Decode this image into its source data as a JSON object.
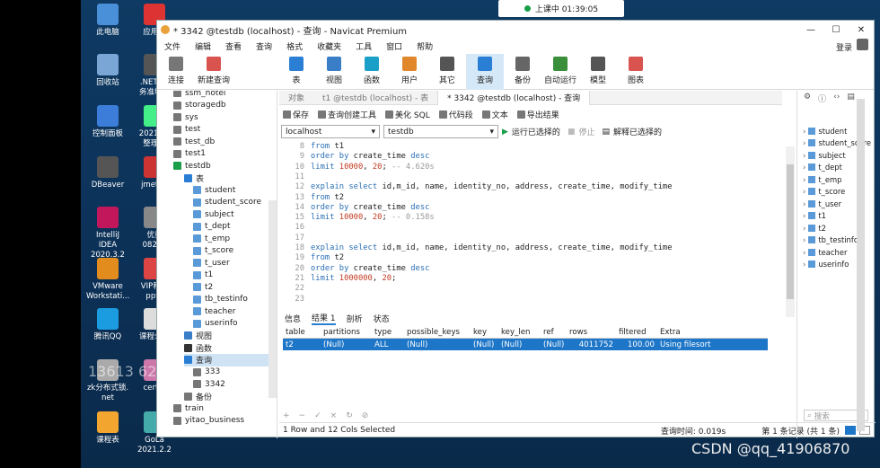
{
  "taskbar": {
    "timer": "上课中 01:39:05"
  },
  "desktop_icons": [
    {
      "label": "此电脑",
      "icon": "computer-icon"
    },
    {
      "label": "应用程",
      "icon": "app-icon"
    },
    {
      "label": "回收站",
      "icon": "recycle-bin-icon"
    },
    {
      "label": ".NET6+\n务准地质",
      "icon": "folder-icon"
    },
    {
      "label": "控制面板",
      "icon": "control-panel-icon"
    },
    {
      "label": "2021Jav\n整理笔",
      "icon": "folder-icon"
    },
    {
      "label": "DBeaver",
      "icon": "dbeaver-icon"
    },
    {
      "label": "jmeter.",
      "icon": "jmeter-icon"
    },
    {
      "label": "IntelliJ IDEA\n2020.3.2 ...",
      "icon": "intellij-icon"
    },
    {
      "label": "优重\n0823.j",
      "icon": "file-icon"
    },
    {
      "label": "VMware\nWorkstati...",
      "icon": "vmware-icon"
    },
    {
      "label": "VIP和公\npptx",
      "icon": "ppt-icon"
    },
    {
      "label": "腾讯QQ",
      "icon": "qq-icon"
    },
    {
      "label": "课程公告",
      "icon": "doc-icon"
    },
    {
      "label": "zk分布式锁.\nnet",
      "icon": "file-icon"
    },
    {
      "label": "cert.p",
      "icon": "cert-icon"
    },
    {
      "label": "课程表",
      "icon": "schedule-icon"
    },
    {
      "label": "GoLa\n2021.2.2",
      "icon": "goland-icon"
    }
  ],
  "window": {
    "title": "* 3342 @testdb (localhost) - 查询 - Navicat Premium",
    "login": "登录"
  },
  "menu": [
    "文件",
    "编辑",
    "查看",
    "查询",
    "格式",
    "收藏夹",
    "工具",
    "窗口",
    "帮助"
  ],
  "toolbar": [
    {
      "label": "连接",
      "icon": "connect-icon"
    },
    {
      "label": "新建查询",
      "icon": "new-query-icon"
    },
    {
      "label": "表",
      "icon": "table-icon"
    },
    {
      "label": "视图",
      "icon": "view-icon"
    },
    {
      "label": "函数",
      "icon": "function-icon"
    },
    {
      "label": "用户",
      "icon": "user-icon"
    },
    {
      "label": "其它",
      "icon": "other-icon"
    },
    {
      "label": "查询",
      "icon": "query-icon"
    },
    {
      "label": "备份",
      "icon": "backup-icon"
    },
    {
      "label": "自动运行",
      "icon": "auto-run-icon"
    },
    {
      "label": "模型",
      "icon": "model-icon"
    },
    {
      "label": "图表",
      "icon": "chart-icon"
    }
  ],
  "nav_tree": [
    {
      "label": "ssm_hotel",
      "level": 1,
      "icon": "db"
    },
    {
      "label": "storagedb",
      "level": 1,
      "icon": "db"
    },
    {
      "label": "sys",
      "level": 1,
      "icon": "db"
    },
    {
      "label": "test",
      "level": 1,
      "icon": "db"
    },
    {
      "label": "test_db",
      "level": 1,
      "icon": "db"
    },
    {
      "label": "test1",
      "level": 1,
      "icon": "db"
    },
    {
      "label": "testdb",
      "level": 1,
      "icon": "db-open"
    },
    {
      "label": "表",
      "level": 2,
      "icon": "tables"
    },
    {
      "label": "student",
      "level": 3,
      "icon": "table"
    },
    {
      "label": "student_score",
      "level": 3,
      "icon": "table"
    },
    {
      "label": "subject",
      "level": 3,
      "icon": "table"
    },
    {
      "label": "t_dept",
      "level": 3,
      "icon": "table"
    },
    {
      "label": "t_emp",
      "level": 3,
      "icon": "table"
    },
    {
      "label": "t_score",
      "level": 3,
      "icon": "table"
    },
    {
      "label": "t_user",
      "level": 3,
      "icon": "table"
    },
    {
      "label": "t1",
      "level": 3,
      "icon": "table"
    },
    {
      "label": "t2",
      "level": 3,
      "icon": "table"
    },
    {
      "label": "tb_testinfo",
      "level": 3,
      "icon": "table"
    },
    {
      "label": "teacher",
      "level": 3,
      "icon": "table"
    },
    {
      "label": "userinfo",
      "level": 3,
      "icon": "table"
    },
    {
      "label": "视图",
      "level": 2,
      "icon": "views"
    },
    {
      "label": "函数",
      "level": 2,
      "icon": "funcs"
    },
    {
      "label": "查询",
      "level": 2,
      "icon": "queries"
    },
    {
      "label": "333",
      "level": 3,
      "icon": "query"
    },
    {
      "label": "3342",
      "level": 3,
      "icon": "query"
    },
    {
      "label": "备份",
      "level": 2,
      "icon": "backups"
    },
    {
      "label": "train",
      "level": 1,
      "icon": "db"
    },
    {
      "label": "yitao_business",
      "level": 1,
      "icon": "db"
    }
  ],
  "tabs": [
    {
      "label": "对象",
      "active": false
    },
    {
      "label": "t1 @testdb (localhost) - 表",
      "active": false
    },
    {
      "label": "* 3342 @testdb (localhost) - 查询",
      "active": true
    }
  ],
  "query_toolbar": [
    "保存",
    "查询创建工具",
    "美化 SQL",
    "代码段",
    "文本",
    "导出结果"
  ],
  "connection": {
    "server": "localhost",
    "database": "testdb",
    "run_selected": "运行已选择的",
    "stop": "停止",
    "explain_selected": "解释已选择的"
  },
  "code_lines": [
    {
      "n": "8",
      "text": "from t1"
    },
    {
      "n": "9",
      "text": "order by create_time desc"
    },
    {
      "n": "10",
      "text": "limit 10000, 20; -- 4.620s"
    },
    {
      "n": "11",
      "text": ""
    },
    {
      "n": "12",
      "text": "explain select id,m_id, name, identity_no, address, create_time, modify_time"
    },
    {
      "n": "13",
      "text": "from t2"
    },
    {
      "n": "14",
      "text": "order by create_time desc"
    },
    {
      "n": "15",
      "text": "limit 10000, 20; -- 0.158s"
    },
    {
      "n": "16",
      "text": ""
    },
    {
      "n": "17",
      "text": ""
    },
    {
      "n": "18",
      "text": "explain select id,m_id, name, identity_no, address, create_time, modify_time"
    },
    {
      "n": "19",
      "text": "from t2"
    },
    {
      "n": "20",
      "text": "order by create_time desc"
    },
    {
      "n": "21",
      "text": "limit 1000000, 20;"
    },
    {
      "n": "22",
      "text": ""
    },
    {
      "n": "23",
      "text": ""
    }
  ],
  "result_tabs": [
    "信息",
    "结果 1",
    "剖析",
    "状态"
  ],
  "result_table": {
    "columns": [
      "table",
      "partitions",
      "type",
      "possible_keys",
      "key",
      "key_len",
      "ref",
      "rows",
      "filtered",
      "Extra"
    ],
    "rows": [
      [
        "t2",
        "(Null)",
        "ALL",
        "(Null)",
        "(Null)",
        "(Null)",
        "(Null)",
        "4011752",
        "100.00",
        "Using filesort"
      ]
    ]
  },
  "grid_footer": [
    "+",
    "−",
    "✓",
    "×",
    "↻",
    "⊘"
  ],
  "status": {
    "left": "1 Row and 12 Cols Selected",
    "query_time": "查询时间: 0.019s",
    "record": "第 1 条记录 (共 1 条)"
  },
  "right_panel": [
    "student",
    "student_score",
    "subject",
    "t_dept",
    "t_emp",
    "t_score",
    "t_user",
    "t1",
    "t2",
    "tb_testinfo",
    "teacher",
    "userinfo"
  ],
  "search_placeholder": "搜索",
  "watermark": "13613 621 观看直播",
  "csdn": "CSDN @qq_41906870"
}
